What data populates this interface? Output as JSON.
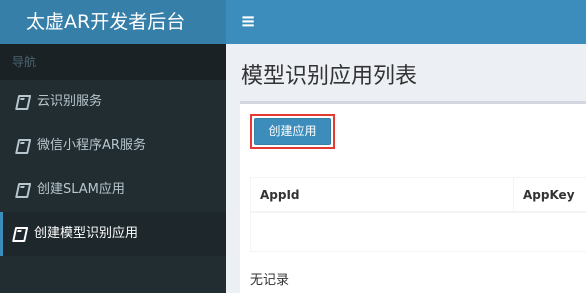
{
  "header": {
    "logo_text": "太虚AR开发者后台",
    "toggle_icon": "≡"
  },
  "sidebar": {
    "section_label": "导航",
    "items": [
      {
        "label": "云识别服务",
        "icon": "book-icon",
        "active": false
      },
      {
        "label": "微信小程序AR服务",
        "icon": "book-icon",
        "active": false
      },
      {
        "label": "创建SLAM应用",
        "icon": "book-icon",
        "active": false
      },
      {
        "label": "创建模型识别应用",
        "icon": "book-icon",
        "active": true
      }
    ]
  },
  "main": {
    "page_title": "模型识别应用列表",
    "create_button_label": "创建应用",
    "table": {
      "columns": [
        "AppId",
        "AppKey"
      ],
      "rows": []
    },
    "empty_text": "无记录"
  },
  "colors": {
    "header": "#3c8dbc",
    "logo_bg": "#367fa9",
    "sidebar": "#222d32",
    "highlight_border": "#e53935"
  }
}
